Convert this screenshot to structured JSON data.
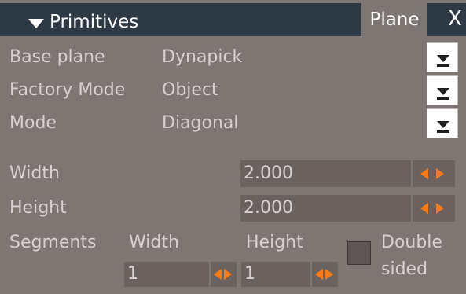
{
  "header": {
    "title": "Primitives",
    "tab_label": "Plane",
    "close_glyph": "X"
  },
  "rows": {
    "base_plane": {
      "label": "Base plane",
      "value": "Dynapick"
    },
    "factory_mode": {
      "label": "Factory Mode",
      "value": "Object"
    },
    "mode": {
      "label": "Mode",
      "value": "Diagonal"
    }
  },
  "size": {
    "width_label": "Width",
    "width_value": "2.000",
    "height_label": "Height",
    "height_value": "2.000"
  },
  "segments": {
    "label": "Segments",
    "width_label": "Width",
    "width_value": "1",
    "height_label": "Height",
    "height_value": "1"
  },
  "double_sided": {
    "label_line1": "Double",
    "label_line2": "sided",
    "checked": false
  },
  "colors": {
    "panel_bg": "#7e7673",
    "titlebar_bg": "#2d3a45",
    "spin_accent": "#ff7a10"
  },
  "icons": [
    "collapse-arrow-icon",
    "close-icon",
    "dropdown-arrow-icon",
    "spinner-arrows-icon"
  ]
}
